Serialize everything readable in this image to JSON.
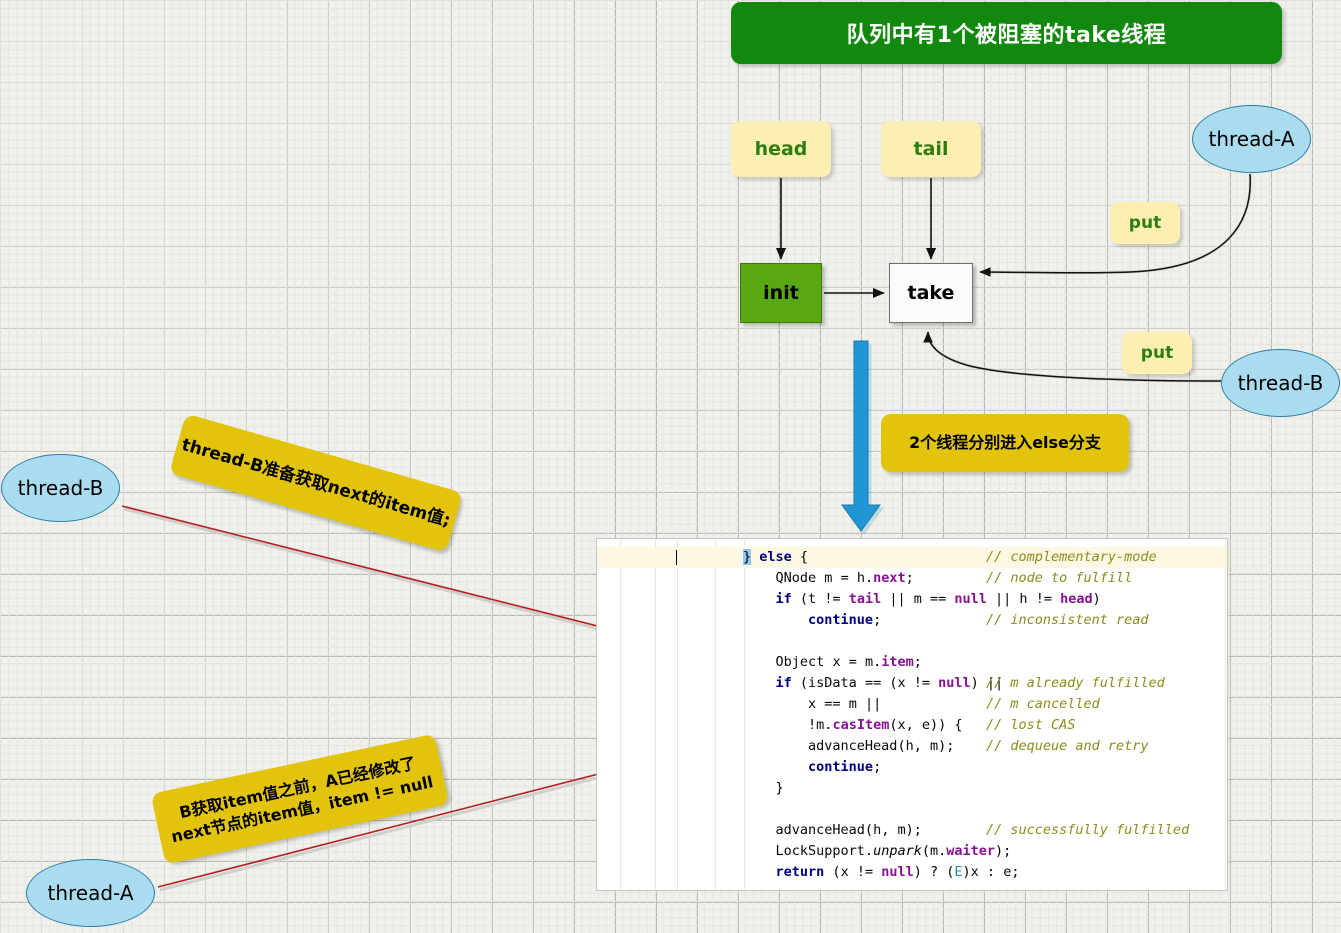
{
  "title": {
    "text": "队列中有1个被阻塞的take线程",
    "color": "#12890e"
  },
  "nodes": {
    "head": "head",
    "tail": "tail",
    "init": "init",
    "take": "take"
  },
  "threads": {
    "right_a": "thread-A",
    "right_b": "thread-B",
    "left_b": "thread-B",
    "left_a": "thread-A"
  },
  "put_labels": {
    "upper": "put",
    "lower": "put"
  },
  "callouts": {
    "else_branch": "2个线程分别进入else分支",
    "note_b": "thread-B准备获取next的item值;",
    "note_a_line1": "B获取item值之前，A已经修改了",
    "note_a_line2": "next节点的item值，item != null"
  },
  "colors": {
    "banner_green": "#12890e",
    "node_yellow": "#fdeeb2",
    "init_green": "#5aa811",
    "thread_blue": "#aadcf0",
    "callout_gold": "#e3c40c",
    "arrow_blue": "#2196d4",
    "annotation_red": "#b42020"
  },
  "code": {
    "language": "java",
    "lines": [
      {
        "indent": 0,
        "highlighted": true,
        "code": "} else {",
        "comment": "// complementary-mode"
      },
      {
        "indent": 0,
        "highlighted": false,
        "code": "    QNode m = h.next;",
        "comment": "// node to fulfill"
      },
      {
        "indent": 0,
        "highlighted": false,
        "code": "    if (t != tail || m == null || h != head)",
        "comment": ""
      },
      {
        "indent": 0,
        "highlighted": false,
        "code": "        continue;",
        "comment": "// inconsistent read"
      },
      {
        "indent": 0,
        "highlighted": false,
        "code": "",
        "comment": ""
      },
      {
        "indent": 0,
        "highlighted": false,
        "code": "    Object x = m.item;",
        "comment": ""
      },
      {
        "indent": 0,
        "highlighted": false,
        "code": "    if (isData == (x != null) ||",
        "comment": "// m already fulfilled"
      },
      {
        "indent": 0,
        "highlighted": false,
        "code": "        x == m ||",
        "comment": "// m cancelled"
      },
      {
        "indent": 0,
        "highlighted": false,
        "code": "        !m.casItem(x, e)) {",
        "comment": "// lost CAS"
      },
      {
        "indent": 0,
        "highlighted": false,
        "code": "        advanceHead(h, m);",
        "comment": "// dequeue and retry"
      },
      {
        "indent": 0,
        "highlighted": false,
        "code": "        continue;",
        "comment": ""
      },
      {
        "indent": 0,
        "highlighted": false,
        "code": "    }",
        "comment": ""
      },
      {
        "indent": 0,
        "highlighted": false,
        "code": "",
        "comment": ""
      },
      {
        "indent": 0,
        "highlighted": false,
        "code": "    advanceHead(h, m);",
        "comment": "// successfully fulfilled"
      },
      {
        "indent": 0,
        "highlighted": false,
        "code": "    LockSupport.unpark(m.waiter);",
        "comment": ""
      },
      {
        "indent": 0,
        "highlighted": false,
        "code": "    return (x != null) ? (E)x : e;",
        "comment": ""
      }
    ]
  }
}
